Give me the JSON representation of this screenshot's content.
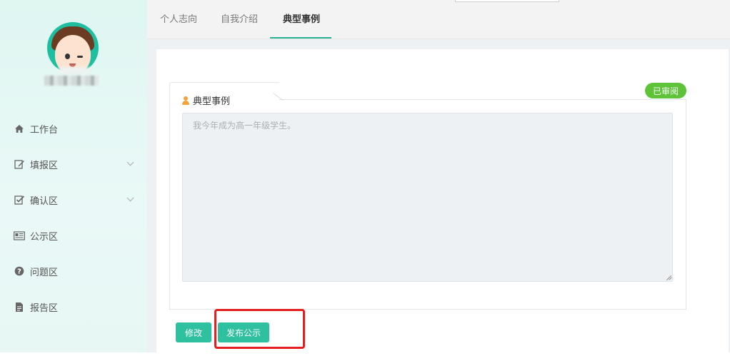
{
  "tabs": [
    {
      "label": "个人志向"
    },
    {
      "label": "自我介绍"
    },
    {
      "label": "典型事例"
    }
  ],
  "sidebar": {
    "items": [
      {
        "label": "工作台",
        "icon": "home-icon"
      },
      {
        "label": "填报区",
        "icon": "edit-icon"
      },
      {
        "label": "确认区",
        "icon": "check-square-icon"
      },
      {
        "label": "公示区",
        "icon": "newspaper-icon"
      },
      {
        "label": "问题区",
        "icon": "question-circle-icon"
      },
      {
        "label": "报告区",
        "icon": "file-icon"
      }
    ]
  },
  "card": {
    "title": "典型事例",
    "status": "已审阅",
    "text": "我今年成为高一年级学生。"
  },
  "actions": {
    "edit_label": "修改",
    "publish_label": "发布公示"
  },
  "colors": {
    "accent": "#2fc0a0",
    "status_badge": "#5fc33a",
    "highlight": "#e41f1f",
    "sidebar_bg": "#dff6f1"
  }
}
